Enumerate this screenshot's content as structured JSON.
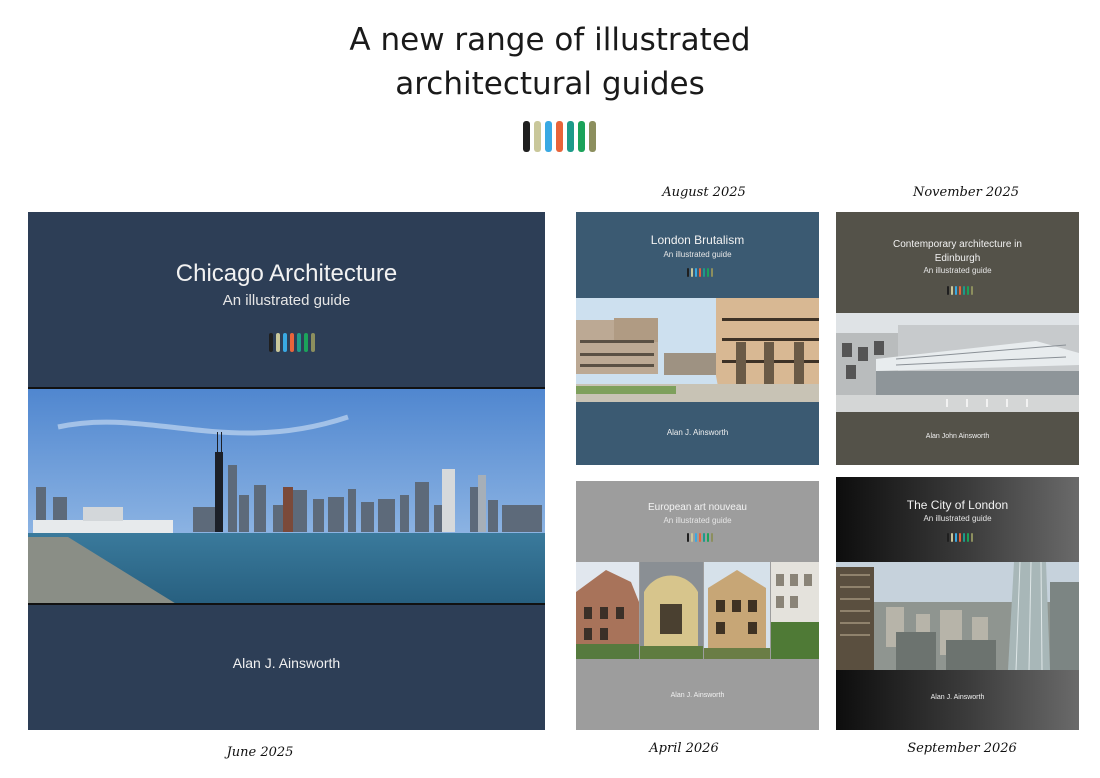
{
  "header": {
    "title_line1": "A new range of illustrated",
    "title_line2": "architectural guides"
  },
  "palette": [
    "#1f1f1f",
    "#c9c79a",
    "#39a9e3",
    "#e8643a",
    "#1d9b8a",
    "#1ba35a",
    "#8c8f5e"
  ],
  "books": [
    {
      "id": "chicago",
      "title": "Chicago Architecture",
      "subtitle": "An illustrated guide",
      "author": "Alan J. Ainsworth",
      "date": "June 2025",
      "cover_color": "#2d3e56"
    },
    {
      "id": "london-brutalism",
      "title": "London Brutalism",
      "subtitle": "An illustrated guide",
      "author": "Alan J. Ainsworth",
      "date": "August 2025",
      "cover_color": "#3b5a72"
    },
    {
      "id": "edinburgh",
      "title_line1": "Contemporary architecture in",
      "title_line2": "Edinburgh",
      "subtitle": "An illustrated guide",
      "author": "Alan John Ainsworth",
      "date": "November 2025",
      "cover_color": "#545249"
    },
    {
      "id": "art-nouveau",
      "title": "European art nouveau",
      "subtitle": "An illustrated guide",
      "author": "Alan J. Ainsworth",
      "date": "April 2026",
      "cover_color": "#9d9d9d"
    },
    {
      "id": "city-of-london",
      "title": "The City of London",
      "subtitle": "An illustrated guide",
      "author": "Alan J. Ainsworth",
      "date": "September 2026",
      "cover_color": "#3a3a3a"
    }
  ]
}
